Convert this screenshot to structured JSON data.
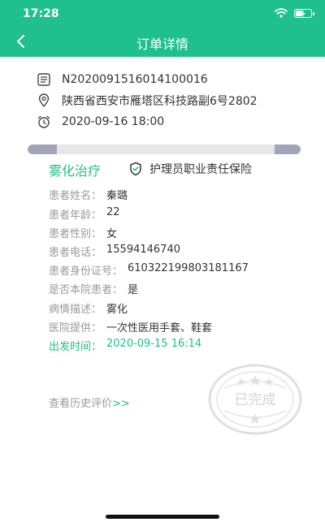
{
  "status_bar": {
    "time": "17:28"
  },
  "header": {
    "title": "订单详情"
  },
  "order": {
    "number": "N2020091516014100016",
    "address": "陕西省西安市雁塔区科技路副6号2802",
    "datetime": "2020-09-16 18:00"
  },
  "service": {
    "name": "雾化治疗",
    "insurance": "护理员职业责任保险"
  },
  "details": [
    {
      "label": "患者姓名：",
      "value": "秦璐"
    },
    {
      "label": "患者年龄：",
      "value": "22"
    },
    {
      "label": "患者性别：",
      "value": "女"
    },
    {
      "label": "患者电话：",
      "value": "15594146740"
    },
    {
      "label": "患者身份证号：",
      "value": "610322199803181167"
    },
    {
      "label": "是否本院患者：",
      "value": "是"
    },
    {
      "label": "病情描述：",
      "value": "雾化"
    },
    {
      "label": "医院提供：",
      "value": "一次性医用手套、鞋套"
    },
    {
      "label": "出发时间：",
      "value": "2020-09-15 16:14"
    }
  ],
  "review": {
    "label": "查看历史评价",
    "arrow": ">>"
  },
  "stamp": {
    "text": "已完成"
  },
  "colors": {
    "primary": "#1fc08b",
    "muted": "#9a9a9a",
    "text": "#333333"
  },
  "icons": [
    "back-arrow-icon",
    "wifi-icon",
    "battery-icon",
    "document-icon",
    "location-pin-icon",
    "alarm-clock-icon",
    "shield-icon"
  ]
}
